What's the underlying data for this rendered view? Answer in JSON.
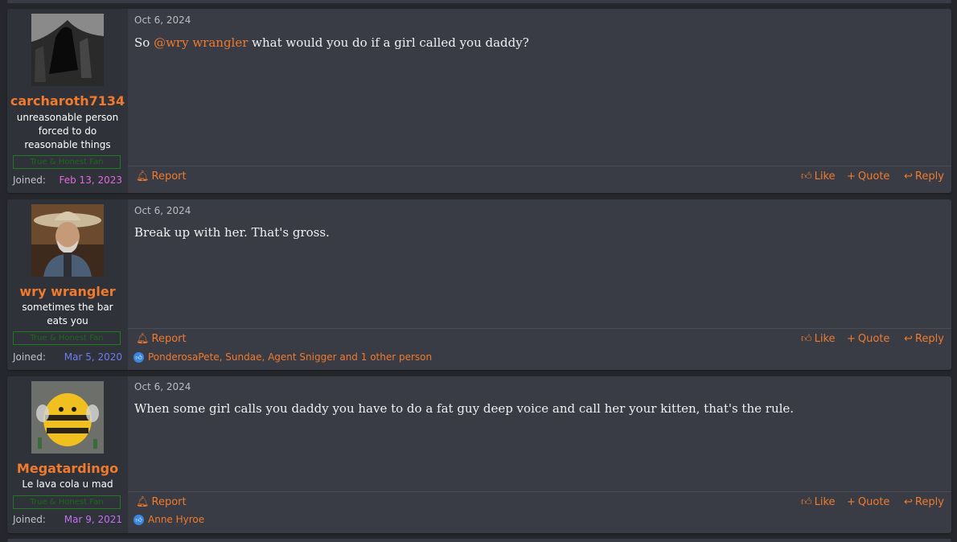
{
  "posts": [
    {
      "username": "carcharoth7134",
      "user_title": "unreasonable person forced to do reasonable things",
      "banner": "True & Honest Fan",
      "joined_label": "Joined:",
      "joined_date": "Feb 13, 2023",
      "joined_color": "#e06adf",
      "date": "Oct 6, 2024",
      "body_prefix": "So ",
      "mention": "@wry wrangler",
      "body_suffix": " what would you do if a girl called you daddy?",
      "report": "Report",
      "like": "Like",
      "quote": "Quote",
      "reply": "Reply"
    },
    {
      "username": "wry wrangler",
      "user_title": "sometimes the bar eats you",
      "banner": "True & Honest Fan",
      "joined_label": "Joined:",
      "joined_date": "Mar 5, 2020",
      "joined_color": "#6e7cf0",
      "date": "Oct 6, 2024",
      "body": "Break up with her. That's gross.",
      "report": "Report",
      "like": "Like",
      "quote": "Quote",
      "reply": "Reply",
      "reactions": "PonderosaPete, Sundae, Agent Snigger and 1 other person"
    },
    {
      "username": "Megatardingo",
      "user_title": "Le lava cola u mad",
      "banner": "True & Honest Fan",
      "joined_label": "Joined:",
      "joined_date": "Mar 9, 2021",
      "joined_color": "#c070f0",
      "date": "Oct 6, 2024",
      "body": "When some girl calls you daddy you have to do a fat guy deep voice and call her your kitten, that's the rule.",
      "report": "Report",
      "like": "Like",
      "quote": "Quote",
      "reply": "Reply",
      "reactions": "Anne Hyroe"
    }
  ],
  "icons": {
    "report": "bell-icon",
    "like": "thumbs-up-icon",
    "quote": "plus-icon",
    "reply": "reply-arrow-icon",
    "reaction": "like-reaction-icon"
  },
  "colors": {
    "accent": "#f07a2e",
    "post_bg": "#393c44",
    "userbox_bg": "#2f3238",
    "page_bg": "#25272c"
  }
}
